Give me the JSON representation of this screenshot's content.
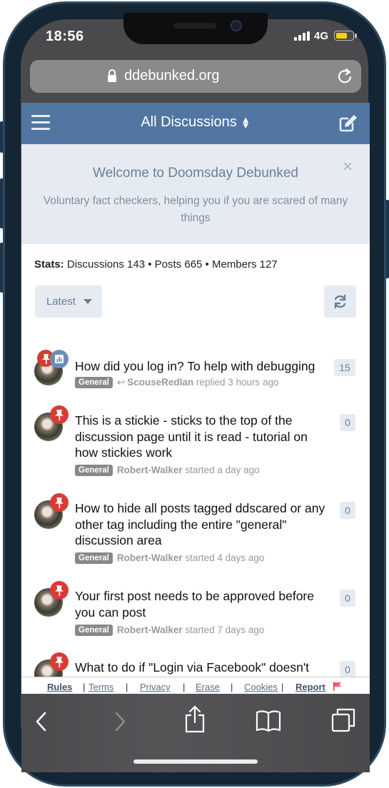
{
  "status": {
    "time": "18:56",
    "network": "4G"
  },
  "browser": {
    "url": "ddebunked.org"
  },
  "header": {
    "title": "All Discussions"
  },
  "welcome": {
    "title": "Welcome to Doomsday Debunked",
    "subtitle": "Voluntary fact checkers, helping you if you are scared of many things",
    "close": "×"
  },
  "stats": {
    "label": "Stats:",
    "text": "Discussions 143 • Posts 665 • Members 127"
  },
  "controls": {
    "sort_label": "Latest"
  },
  "discussions": [
    {
      "title": "How did you log in? To help with debugging",
      "tag": "General",
      "user": "ScouseRedIan",
      "action": "replied 3 hours ago",
      "count": "15"
    },
    {
      "title": "This is a stickie - sticks to the top of the discussion page until it is read - tutorial on how stickies work",
      "tag": "General",
      "user": "Robert-Walker",
      "action": "started a day ago",
      "count": "0"
    },
    {
      "title": "How to hide all posts tagged ddscared or any other tag including the entire \"general\" discussion area",
      "tag": "General",
      "user": "Robert-Walker",
      "action": "started 4 days ago",
      "count": "0"
    },
    {
      "title": "Your first post needs to be approved before you can post",
      "tag": "General",
      "user": "Robert-Walker",
      "action": "started 7 days ago",
      "count": "0"
    },
    {
      "title": "What to do if \"Login via Facebook\" doesn't work",
      "tag": "",
      "user": "",
      "action": "",
      "count": "0"
    }
  ],
  "footer": {
    "rules": "Rules",
    "terms": "Terms",
    "privacy": "Privacy",
    "erase": "Erase",
    "cookies": "Cookies",
    "report": "Report",
    "sep": "|"
  },
  "colors": {
    "header_bg": "#5176a2",
    "welcome_bg": "#e6ebf2",
    "pin": "#d83b36",
    "poll": "#6e8db3",
    "tag": "#888888"
  }
}
